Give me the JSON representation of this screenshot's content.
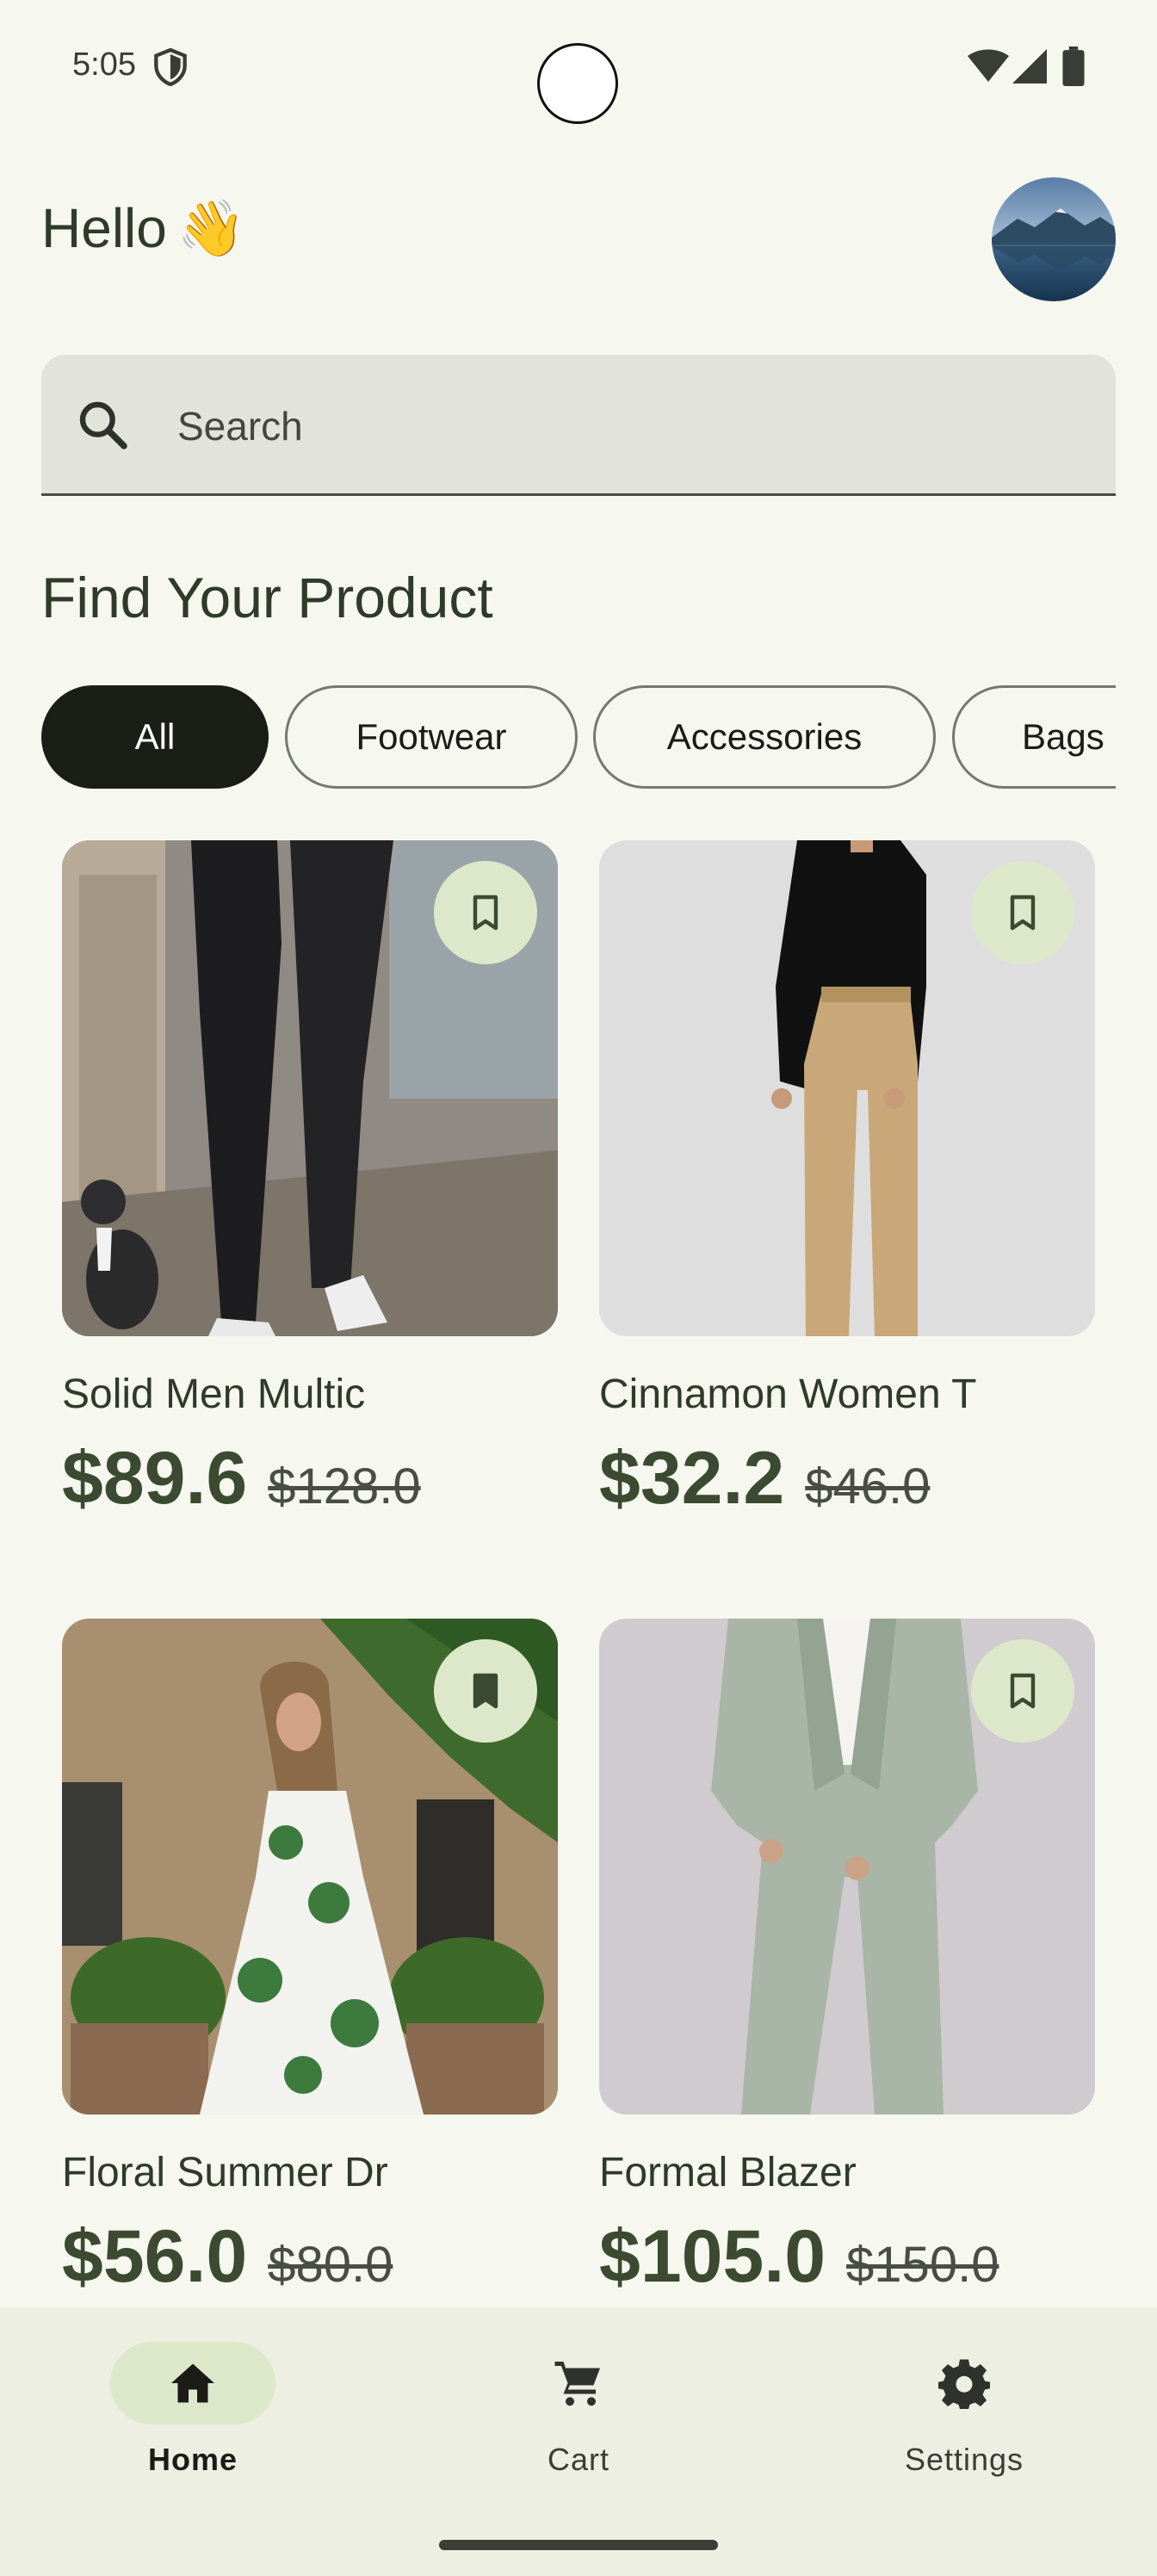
{
  "status_bar": {
    "time": "5:05",
    "icons": [
      "shield-icon",
      "wifi-icon",
      "signal-icon",
      "battery-icon"
    ]
  },
  "header": {
    "greeting": "Hello",
    "greeting_emoji": "👋",
    "avatar_icon": "avatar-mountain-lake"
  },
  "search": {
    "placeholder": "Search",
    "icon": "search-icon"
  },
  "section_title": "Find Your Product",
  "categories": {
    "selected": "All",
    "items": [
      "All",
      "Footwear",
      "Accessories",
      "Bags"
    ]
  },
  "products": [
    {
      "title": "Solid Men Multic",
      "price": "$89.6",
      "old_price": "$128.0",
      "bookmarked": false,
      "image": "black-trousers-photo"
    },
    {
      "title": "Cinnamon Women T",
      "price": "$32.2",
      "old_price": "$46.0",
      "bookmarked": false,
      "image": "tan-trousers-photo"
    },
    {
      "title": "Floral Summer Dr",
      "price": "$56.0",
      "old_price": "$80.0",
      "bookmarked": true,
      "image": "floral-dress-photo"
    },
    {
      "title": "Formal Blazer",
      "price": "$105.0",
      "old_price": "$150.0",
      "bookmarked": false,
      "image": "grey-suit-photo"
    }
  ],
  "bottom_nav": {
    "items": [
      {
        "label": "Home",
        "icon": "home-icon",
        "active": true
      },
      {
        "label": "Cart",
        "icon": "cart-icon",
        "active": false
      },
      {
        "label": "Settings",
        "icon": "gear-icon",
        "active": false
      }
    ]
  },
  "colors": {
    "background": "#f6f7ef",
    "primary_text": "#2e3a2a",
    "price": "#3b4a30",
    "chip_selected": "#1b1d17",
    "bookmark_bg": "#dde8cb",
    "nav_bg": "#edefe3"
  }
}
